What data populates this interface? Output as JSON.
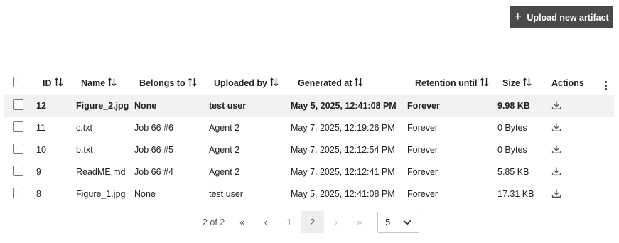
{
  "upload_button": {
    "icon": "plus-icon",
    "label": "Upload new artifact"
  },
  "columns": {
    "id": "ID",
    "name": "Name",
    "belongs_to": "Belongs to",
    "uploaded_by": "Uploaded by",
    "generated_at": "Generated at",
    "retention_until": "Retention until",
    "size": "Size",
    "actions": "Actions"
  },
  "rows": [
    {
      "id": "12",
      "name": "Figure_2.jpg",
      "belongs_to": "None",
      "uploaded_by": "test user",
      "generated_at": "May 5, 2025, 12:41:08 PM",
      "retention_until": "Forever",
      "size": "9.98 KB",
      "selected": true
    },
    {
      "id": "11",
      "name": "c.txt",
      "belongs_to": "Job 66 #6",
      "uploaded_by": "Agent 2",
      "generated_at": "May 7, 2025, 12:19:26 PM",
      "retention_until": "Forever",
      "size": "0 Bytes",
      "selected": false
    },
    {
      "id": "10",
      "name": "b.txt",
      "belongs_to": "Job 66 #5",
      "uploaded_by": "Agent 2",
      "generated_at": "May 7, 2025, 12:12:54 PM",
      "retention_until": "Forever",
      "size": "0 Bytes",
      "selected": false
    },
    {
      "id": "9",
      "name": "ReadME.md",
      "belongs_to": "Job 66 #4",
      "uploaded_by": "Agent 2",
      "generated_at": "May 7, 2025, 12:12:41 PM",
      "retention_until": "Forever",
      "size": "5.85 KB",
      "selected": false
    },
    {
      "id": "8",
      "name": "Figure_1.jpg",
      "belongs_to": "None",
      "uploaded_by": "test user",
      "generated_at": "May 5, 2025, 12:41:08 PM",
      "retention_until": "Forever",
      "size": "17.31 KB",
      "selected": false
    }
  ],
  "pagination": {
    "info": "2 of 2",
    "first": "«",
    "prev": "‹",
    "pages": [
      "1",
      "2"
    ],
    "current_page": "2",
    "next": "›",
    "last": "»",
    "page_size": "5"
  },
  "colors": {
    "button_bg": "#4a4a4a",
    "selected_row_bg": "#f2f2f2",
    "active_page_bg": "#eeeeee"
  }
}
